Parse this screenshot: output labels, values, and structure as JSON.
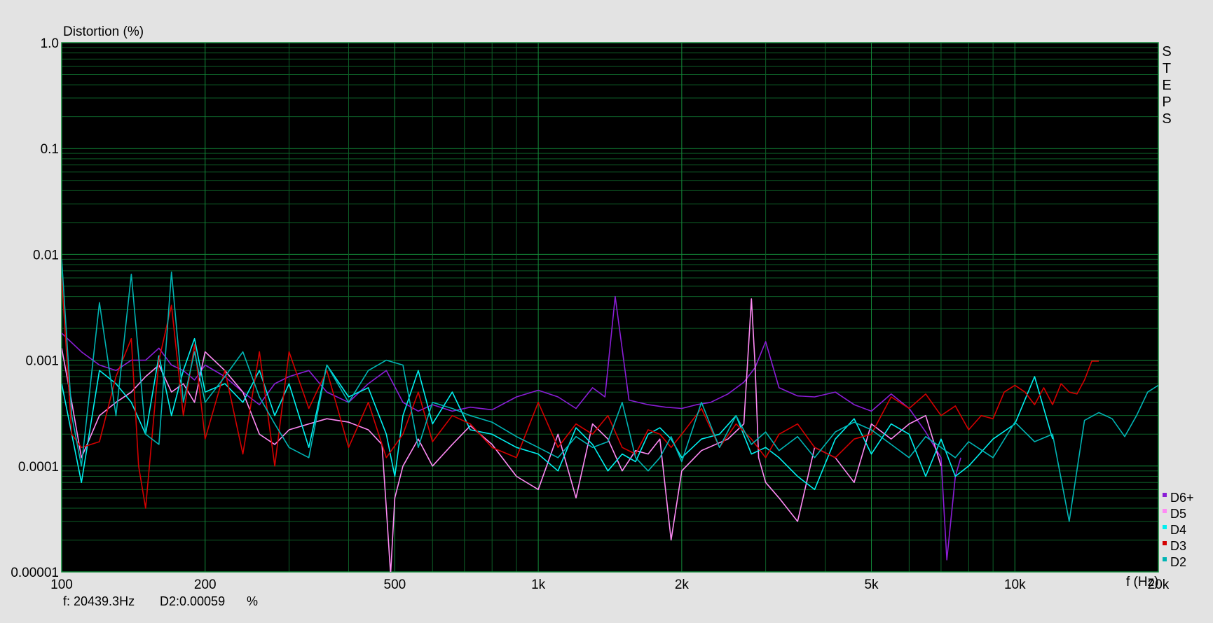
{
  "chart_data": {
    "type": "line",
    "ylabel": "Distortion (%)",
    "xlabel": "f (Hz)",
    "xscale": "log",
    "yscale": "log",
    "xlim": [
      100,
      20000
    ],
    "ylim": [
      1e-05,
      1.0
    ],
    "grid": true,
    "legend_position": "bottom-right",
    "x_ticks": [
      {
        "value": 100,
        "label": "100"
      },
      {
        "value": 200,
        "label": "200"
      },
      {
        "value": 500,
        "label": "500"
      },
      {
        "value": 1000,
        "label": "1k"
      },
      {
        "value": 2000,
        "label": "2k"
      },
      {
        "value": 5000,
        "label": "5k"
      },
      {
        "value": 10000,
        "label": "10k"
      },
      {
        "value": 20000,
        "label": "20k"
      }
    ],
    "y_ticks": [
      {
        "value": 1.0,
        "label": "1.0"
      },
      {
        "value": 0.1,
        "label": "0.1"
      },
      {
        "value": 0.01,
        "label": "0.01"
      },
      {
        "value": 0.001,
        "label": "0.001"
      },
      {
        "value": 0.0001,
        "label": "0.0001"
      },
      {
        "value": 1e-05,
        "label": "0.00001"
      }
    ],
    "series": [
      {
        "name": "D6+",
        "color": "#8a1ed6",
        "x": [
          100,
          110,
          120,
          130,
          140,
          150,
          160,
          170,
          180,
          190,
          200,
          220,
          240,
          260,
          280,
          300,
          330,
          360,
          400,
          440,
          480,
          520,
          560,
          600,
          660,
          720,
          800,
          900,
          1000,
          1100,
          1200,
          1300,
          1380,
          1450,
          1550,
          1700,
          1850,
          2000,
          2150,
          2300,
          2500,
          2700,
          2850,
          3000,
          3200,
          3500,
          3800,
          4200,
          4600,
          5000,
          5500,
          6000,
          6500,
          7000,
          7200,
          7500,
          7700
        ],
        "values": [
          0.0018,
          0.0012,
          0.0009,
          0.0008,
          0.001,
          0.001,
          0.0013,
          0.0009,
          0.0008,
          0.00065,
          0.0009,
          0.0007,
          0.0005,
          0.00038,
          0.0006,
          0.0007,
          0.0008,
          0.0005,
          0.0004,
          0.0006,
          0.0008,
          0.0004,
          0.00033,
          0.00038,
          0.00033,
          0.00036,
          0.00034,
          0.00045,
          0.00052,
          0.00045,
          0.00035,
          0.00055,
          0.00045,
          0.004,
          0.00042,
          0.00038,
          0.00036,
          0.00035,
          0.00038,
          0.0004,
          0.00048,
          0.00062,
          0.00085,
          0.0015,
          0.00055,
          0.00046,
          0.00045,
          0.0005,
          0.00038,
          0.00033,
          0.00048,
          0.00035,
          0.00021,
          0.00012,
          1.3e-05,
          8e-05,
          0.00012
        ]
      },
      {
        "name": "D5",
        "color": "#ff8af5",
        "x": [
          100,
          105,
          110,
          120,
          130,
          140,
          150,
          160,
          170,
          180,
          190,
          200,
          220,
          240,
          260,
          280,
          300,
          330,
          360,
          400,
          440,
          470,
          480,
          490,
          500,
          520,
          560,
          600,
          660,
          720,
          800,
          900,
          1000,
          1100,
          1200,
          1300,
          1400,
          1500,
          1600,
          1700,
          1800,
          1900,
          2000,
          2200,
          2500,
          2700,
          2800,
          2850,
          2900,
          3000,
          3200,
          3500,
          3800,
          4200,
          4600,
          5000,
          5500,
          6000,
          6500,
          7000
        ],
        "values": [
          0.0013,
          0.0004,
          0.00012,
          0.0003,
          0.0004,
          0.0005,
          0.0007,
          0.0009,
          0.0005,
          0.0006,
          0.0004,
          0.0012,
          0.0008,
          0.0005,
          0.0002,
          0.00016,
          0.00022,
          0.00025,
          0.00028,
          0.00026,
          0.00022,
          0.00016,
          4e-05,
          9.5e-06,
          5e-05,
          0.0001,
          0.00018,
          0.0001,
          0.00016,
          0.00024,
          0.00016,
          8e-05,
          6e-05,
          0.0002,
          5e-05,
          0.00025,
          0.00018,
          9e-05,
          0.00014,
          0.00013,
          0.00018,
          2e-05,
          9e-05,
          0.00014,
          0.00018,
          0.00025,
          0.0038,
          0.0009,
          0.00012,
          7e-05,
          5e-05,
          3e-05,
          0.00015,
          0.00012,
          7e-05,
          0.00025,
          0.00018,
          0.00025,
          0.0003,
          0.0001
        ]
      },
      {
        "name": "D4",
        "color": "#00f0f0",
        "x": [
          100,
          110,
          120,
          130,
          140,
          150,
          160,
          170,
          180,
          190,
          200,
          220,
          240,
          260,
          280,
          300,
          330,
          360,
          400,
          440,
          480,
          500,
          520,
          560,
          600,
          660,
          720,
          800,
          900,
          1000,
          1100,
          1200,
          1300,
          1400,
          1500,
          1600,
          1700,
          1800,
          1900,
          2000,
          2200,
          2400,
          2600,
          2800,
          3000,
          3200,
          3500,
          3800,
          4200,
          4600,
          5000,
          5500,
          6000,
          6500,
          7000,
          7500,
          8000,
          9000,
          10000,
          11000,
          12000
        ],
        "values": [
          0.0006,
          7e-05,
          0.0008,
          0.0006,
          0.0004,
          0.0002,
          0.0011,
          0.0003,
          0.0008,
          0.0016,
          0.0005,
          0.0006,
          0.0004,
          0.0008,
          0.0003,
          0.0006,
          0.00015,
          0.0009,
          0.00045,
          0.00055,
          0.0002,
          8e-05,
          0.0003,
          0.0008,
          0.00025,
          0.0005,
          0.00022,
          0.0002,
          0.00015,
          0.00013,
          9e-05,
          0.00023,
          0.00016,
          9e-05,
          0.00013,
          0.00011,
          0.0002,
          0.00023,
          0.00018,
          0.00012,
          0.00018,
          0.0002,
          0.0003,
          0.00013,
          0.00015,
          0.00012,
          8e-05,
          6e-05,
          0.00018,
          0.00028,
          0.00013,
          0.00025,
          0.0002,
          8e-05,
          0.00018,
          8e-05,
          0.0001,
          0.00018,
          0.00025,
          0.0007,
          0.00018
        ]
      },
      {
        "name": "D3",
        "color": "#d40000",
        "x": [
          100,
          105,
          110,
          120,
          130,
          140,
          145,
          150,
          160,
          170,
          180,
          190,
          200,
          220,
          240,
          260,
          280,
          300,
          330,
          360,
          400,
          440,
          480,
          520,
          560,
          600,
          660,
          720,
          800,
          900,
          1000,
          1100,
          1200,
          1300,
          1400,
          1500,
          1600,
          1700,
          1800,
          1900,
          2000,
          2200,
          2400,
          2600,
          2800,
          3000,
          3200,
          3500,
          3800,
          4200,
          4600,
          5000,
          5500,
          6000,
          6500,
          7000,
          7500,
          8000,
          8500,
          9000,
          9500,
          10000,
          10500,
          11000,
          11500,
          12000,
          12500,
          13000,
          13500,
          14000,
          14500,
          15000
        ],
        "values": [
          0.006,
          0.0002,
          0.00015,
          0.00017,
          0.0007,
          0.0016,
          0.0001,
          4e-05,
          0.001,
          0.0033,
          0.0003,
          0.0014,
          0.00018,
          0.0008,
          0.00013,
          0.0012,
          0.0001,
          0.0012,
          0.00035,
          0.0008,
          0.00015,
          0.0004,
          0.00012,
          0.0002,
          0.0005,
          0.00017,
          0.0003,
          0.00025,
          0.00015,
          0.00012,
          0.0004,
          0.00015,
          0.00025,
          0.0002,
          0.0003,
          0.00015,
          0.00013,
          0.00022,
          0.0002,
          0.00015,
          0.0002,
          0.00035,
          0.00015,
          0.00025,
          0.00018,
          0.00012,
          0.0002,
          0.00025,
          0.00015,
          0.00012,
          0.00018,
          0.0002,
          0.00045,
          0.00035,
          0.00048,
          0.0003,
          0.00037,
          0.00022,
          0.0003,
          0.00028,
          0.0005,
          0.00058,
          0.0005,
          0.00038,
          0.00055,
          0.00038,
          0.0006,
          0.0005,
          0.00048,
          0.00065,
          0.00098,
          0.00098
        ]
      },
      {
        "name": "D2",
        "color": "#00b4b4",
        "x": [
          100,
          105,
          110,
          120,
          130,
          140,
          150,
          160,
          170,
          180,
          190,
          200,
          220,
          240,
          260,
          280,
          300,
          330,
          360,
          400,
          440,
          480,
          520,
          560,
          600,
          660,
          720,
          800,
          900,
          1000,
          1100,
          1200,
          1300,
          1400,
          1500,
          1600,
          1700,
          1800,
          1900,
          2000,
          2200,
          2400,
          2600,
          2800,
          3000,
          3200,
          3500,
          3800,
          4200,
          4600,
          5000,
          5500,
          6000,
          6500,
          7000,
          7500,
          8000,
          9000,
          10000,
          11000,
          12000,
          13000,
          14000,
          15000,
          16000,
          17000,
          18000,
          19000,
          20000
        ],
        "values": [
          0.009,
          0.0003,
          0.0001,
          0.0035,
          0.0003,
          0.0065,
          0.0002,
          0.00016,
          0.0068,
          0.0004,
          0.0012,
          0.0004,
          0.0007,
          0.0012,
          0.00045,
          0.00025,
          0.00015,
          0.00012,
          0.0009,
          0.0004,
          0.0008,
          0.001,
          0.0009,
          0.00015,
          0.0004,
          0.00035,
          0.0003,
          0.00026,
          0.00019,
          0.00015,
          0.00012,
          0.00019,
          0.00015,
          0.00017,
          0.0004,
          0.00012,
          9e-05,
          0.00012,
          0.00019,
          0.00011,
          0.0004,
          0.00015,
          0.0003,
          0.00016,
          0.00021,
          0.00014,
          0.00019,
          0.00012,
          0.00021,
          0.00026,
          0.00022,
          0.00016,
          0.00012,
          0.00019,
          0.00015,
          0.00012,
          0.00017,
          0.00012,
          0.00026,
          0.00017,
          0.0002,
          3e-05,
          0.00027,
          0.00032,
          0.00028,
          0.00019,
          0.0003,
          0.0005,
          0.00058
        ]
      }
    ]
  },
  "side_label": "STEPS",
  "status": {
    "freq_readout": "f: 20439.3Hz",
    "value_readout": "D2:0.00059",
    "unit": "%"
  },
  "colors": {
    "plot_background": "#000000",
    "grid_major": "#138a3a",
    "grid_minor": "#0d5e27",
    "window_background": "#e3e3e3"
  }
}
